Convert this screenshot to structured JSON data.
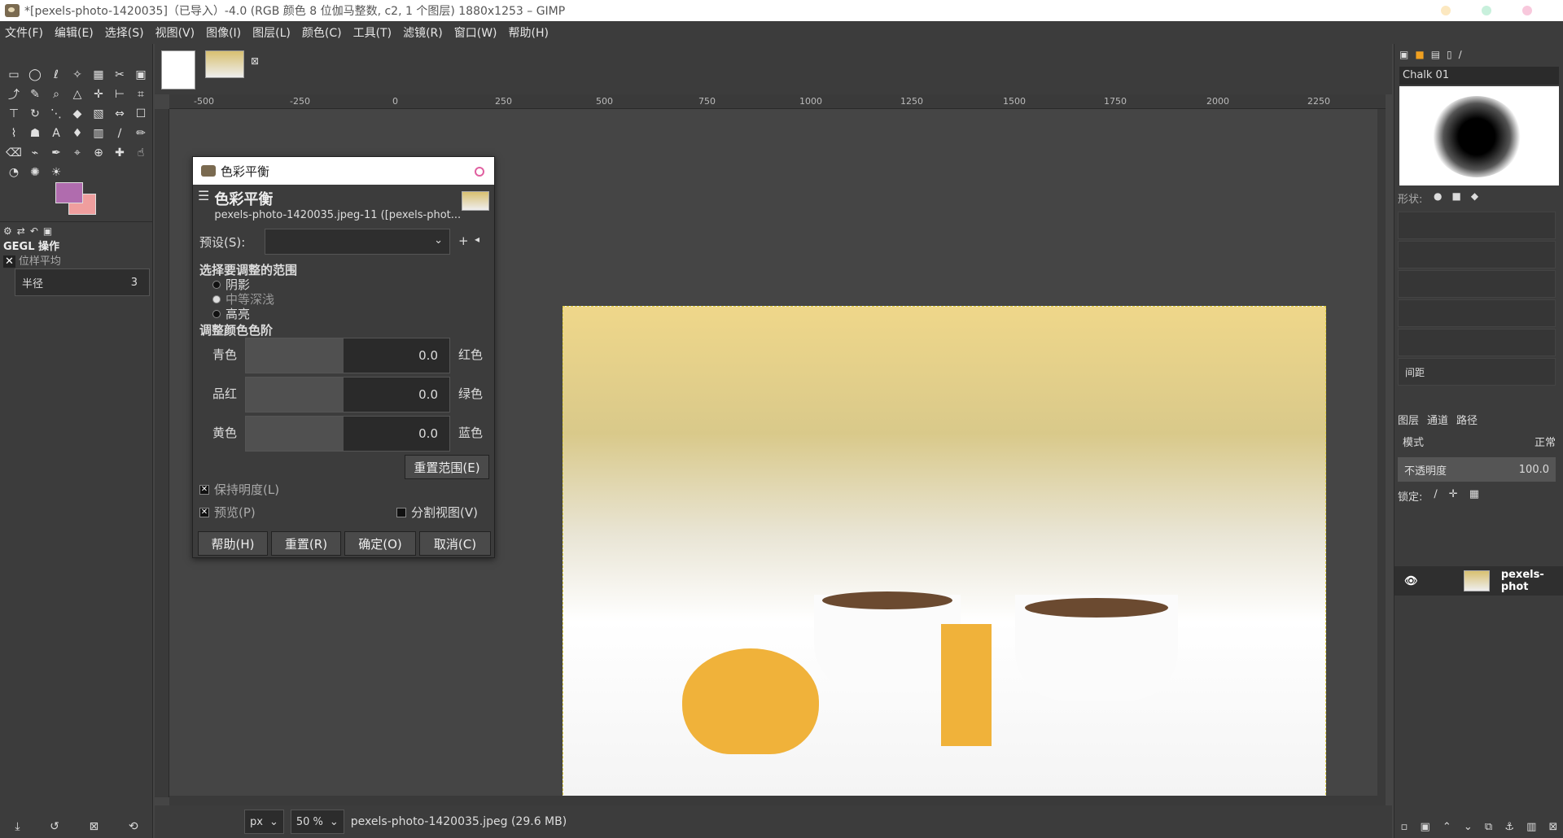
{
  "titlebar": {
    "title": "*[pexels-photo-1420035]（已导入）-4.0 (RGB 颜色 8 位伽马整数, c2, 1 个图层) 1880x1253 – GIMP"
  },
  "menu": [
    "文件(F)",
    "编辑(E)",
    "选择(S)",
    "视图(V)",
    "图像(I)",
    "图层(L)",
    "颜色(C)",
    "工具(T)",
    "滤镜(R)",
    "窗口(W)",
    "帮助(H)"
  ],
  "tool_options": {
    "title": "GEGL 操作",
    "subtitle": "位样平均",
    "radius_label": "半径",
    "radius_value": "3"
  },
  "ruler_labels": [
    "-500",
    "-250",
    "0",
    "250",
    "500",
    "750",
    "1000",
    "1250",
    "1500",
    "1750",
    "2000",
    "2250"
  ],
  "dialog": {
    "window_title": "色彩平衡",
    "heading": "色彩平衡",
    "subheading": "pexels-photo-1420035.jpeg-11 ([pexels-phot...",
    "preset_label": "预设(S):",
    "range_title": "选择要调整的范围",
    "ranges": [
      "阴影",
      "中等深浅",
      "高亮"
    ],
    "levels_title": "调整颜色色阶",
    "sliders": [
      {
        "left": "青色",
        "right": "红色",
        "value": "0.0"
      },
      {
        "left": "品红",
        "right": "绿色",
        "value": "0.0"
      },
      {
        "left": "黄色",
        "right": "蓝色",
        "value": "0.0"
      }
    ],
    "reset_range": "重置范围(E)",
    "preserve": "保持明度(L)",
    "preview": "预览(P)",
    "split": "分割视图(V)",
    "buttons": [
      "帮助(H)",
      "重置(R)",
      "确定(O)",
      "取消(C)"
    ]
  },
  "status": {
    "unit": "px",
    "zoom": "50 %",
    "file": "pexels-photo-1420035.jpeg (29.6 MB)"
  },
  "brushes": {
    "name": "Chalk 01",
    "shape_label": "形状:",
    "spacing_label": "间距"
  },
  "layers": {
    "tabs": [
      "图层",
      "通道",
      "路径"
    ],
    "mode_label": "模式",
    "mode_value": "正常",
    "opacity_label": "不透明度",
    "opacity_value": "100.0",
    "lock_label": "锁定:",
    "layer_name": "pexels-phot"
  }
}
